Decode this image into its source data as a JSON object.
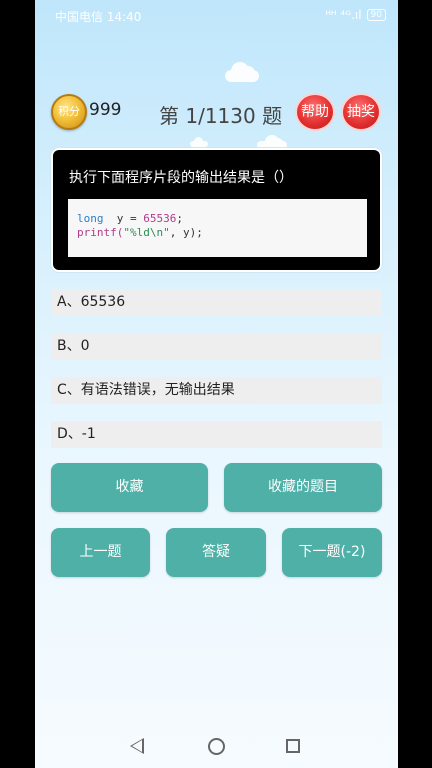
{
  "status_bar": {
    "carrier_time": "中国电信 14:40",
    "signal_icons": "ᵸᵸ ⁴ᴳ.ıl",
    "battery": "90"
  },
  "header": {
    "coin_label": "积分",
    "coin_count": "999",
    "question_counter": "第 1/1130 题",
    "help_label": "帮助",
    "lottery_label": "抽奖"
  },
  "question": {
    "text": "执行下面程序片段的输出结果是（）",
    "code": {
      "line1_kw": "long",
      "line1_mid": "  y = ",
      "line1_num": "65536",
      "line1_end": ";",
      "line2_fn": "printf(",
      "line2_str": "\"%ld\\n\"",
      "line2_end": ", y);"
    }
  },
  "options": [
    {
      "label": "A、65536"
    },
    {
      "label": "B、0"
    },
    {
      "label": "C、有语法错误，无输出结果"
    },
    {
      "label": "D、-1"
    }
  ],
  "actions": {
    "favorite": "收藏",
    "favorite_list": "收藏的题目",
    "prev": "上一题",
    "ask": "答疑",
    "next": "下一题(-2)"
  },
  "colors": {
    "accent_teal": "#4fb0a7",
    "red_button": "#e02d2d"
  }
}
